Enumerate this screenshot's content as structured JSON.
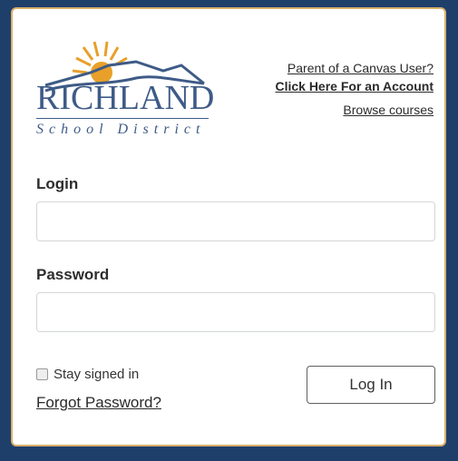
{
  "login_form": {
    "logo": {
      "word": "RICHLAND",
      "sub": "School District"
    },
    "links": {
      "parent_question": "Parent of a Canvas User?",
      "click_here": "Click Here For an Account",
      "browse": "Browse courses"
    },
    "login_label": "Login",
    "password_label": "Password",
    "login_value": "",
    "password_value": "",
    "stay_signed_in": "Stay signed in",
    "forgot_password": "Forgot Password?",
    "log_in_button": "Log In"
  },
  "colors": {
    "background": "#1f3f6b",
    "card_border": "#d9b06a",
    "logo_blue": "#3e5b87",
    "logo_sun": "#e8a02a"
  }
}
